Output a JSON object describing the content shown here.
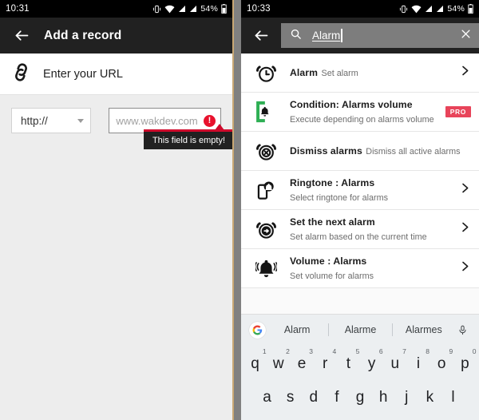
{
  "left": {
    "status_bar": {
      "clock": "10:31",
      "battery_text": "54%",
      "icons": [
        "vibrate-icon",
        "wifi-icon",
        "signal-icon",
        "signal-icon",
        "battery-icon"
      ]
    },
    "toolbar": {
      "back_icon": "arrow-back-icon",
      "title": "Add a record"
    },
    "url_header": {
      "icon": "link-icon",
      "label": "Enter your URL"
    },
    "scheme_select": {
      "value": "http://",
      "caret_icon": "chevron-down-icon"
    },
    "url_input": {
      "value": "",
      "placeholder": "www.wakdev.com",
      "error_icon": "error-exclamation-icon"
    },
    "tooltip": {
      "text": "This field is empty!",
      "accent_color": "#cf0a2c"
    }
  },
  "right": {
    "status_bar": {
      "clock": "10:33",
      "battery_text": "54%",
      "icons": [
        "vibrate-icon",
        "wifi-icon",
        "signal-icon",
        "signal-icon",
        "battery-icon"
      ]
    },
    "toolbar": {
      "back_icon": "arrow-back-icon",
      "search_icon": "search-icon",
      "query": "Alarm",
      "clear_icon": "close-icon"
    },
    "list": [
      {
        "icon": "alarm-clock-icon",
        "title": "Alarm",
        "subtitle": "Set alarm",
        "chevron": "chevron-right-icon",
        "badge": null
      },
      {
        "icon": "condition-bell-icon",
        "title": "Condition: Alarms volume",
        "subtitle": "Execute depending on alarms volume",
        "chevron": null,
        "badge": "PRO"
      },
      {
        "icon": "alarm-dismiss-icon",
        "title": "Dismiss alarms",
        "subtitle": "Dismiss all active alarms",
        "chevron": null,
        "badge": null
      },
      {
        "icon": "phone-ringtone-icon",
        "title": "Ringtone : Alarms",
        "subtitle": "Select ringtone for alarms",
        "chevron": "chevron-right-icon",
        "badge": null
      },
      {
        "icon": "alarm-next-icon",
        "title": "Set the next alarm",
        "subtitle": "Set alarm based on the current time",
        "chevron": "chevron-right-icon",
        "badge": null
      },
      {
        "icon": "bell-ringing-icon",
        "title": "Volume : Alarms",
        "subtitle": "Set volume for alarms",
        "chevron": "chevron-right-icon",
        "badge": null
      }
    ],
    "keyboard": {
      "google_icon": "google-g-icon",
      "suggestions": [
        "Alarm",
        "Alarme",
        "Alarmes"
      ],
      "mic_icon": "microphone-icon",
      "row1": [
        {
          "letter": "q",
          "num": "1"
        },
        {
          "letter": "w",
          "num": "2"
        },
        {
          "letter": "e",
          "num": "3"
        },
        {
          "letter": "r",
          "num": "4"
        },
        {
          "letter": "t",
          "num": "5"
        },
        {
          "letter": "y",
          "num": "6"
        },
        {
          "letter": "u",
          "num": "7"
        },
        {
          "letter": "i",
          "num": "8"
        },
        {
          "letter": "o",
          "num": "9"
        },
        {
          "letter": "p",
          "num": "0"
        }
      ],
      "row2": [
        {
          "letter": "a",
          "num": ""
        },
        {
          "letter": "s",
          "num": ""
        },
        {
          "letter": "d",
          "num": ""
        },
        {
          "letter": "f",
          "num": ""
        },
        {
          "letter": "g",
          "num": ""
        },
        {
          "letter": "h",
          "num": ""
        },
        {
          "letter": "j",
          "num": ""
        },
        {
          "letter": "k",
          "num": ""
        },
        {
          "letter": "l",
          "num": ""
        }
      ]
    }
  },
  "colors": {
    "toolbar": "#212121",
    "pro_badge": "#e8445a",
    "error": "#e8112d",
    "condition_green": "#2eaf54"
  }
}
